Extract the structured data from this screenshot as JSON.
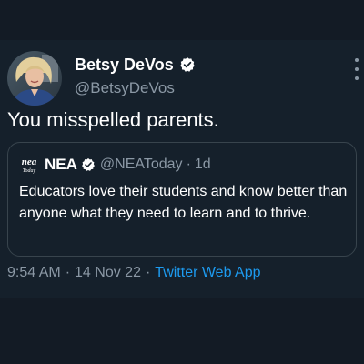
{
  "tweet": {
    "author": {
      "display_name": "Betsy DeVos",
      "handle": "@BetsyDeVos",
      "verified": true
    },
    "text": "You misspelled parents.",
    "timestamp": {
      "time": "9:54 AM",
      "date": "14 Nov 22",
      "source": "Twitter Web App"
    },
    "quoted": {
      "logo_text": "nea",
      "logo_subtext": "Today",
      "display_name": "NEA",
      "verified": true,
      "handle": "@NEAToday",
      "separator": "·",
      "relative_time": "1d",
      "text": "Educators love their students and know better than anyone what they need to learn and to thrive."
    }
  },
  "colors": {
    "background": "#15202b",
    "text": "#ffffff",
    "secondary_text": "#8b98a5",
    "link": "#1d9bf0",
    "verified_badge": "#ffffff",
    "border": "#38444d"
  },
  "icons": {
    "verified": "verified-badge-icon",
    "more": "more-options-icon"
  }
}
